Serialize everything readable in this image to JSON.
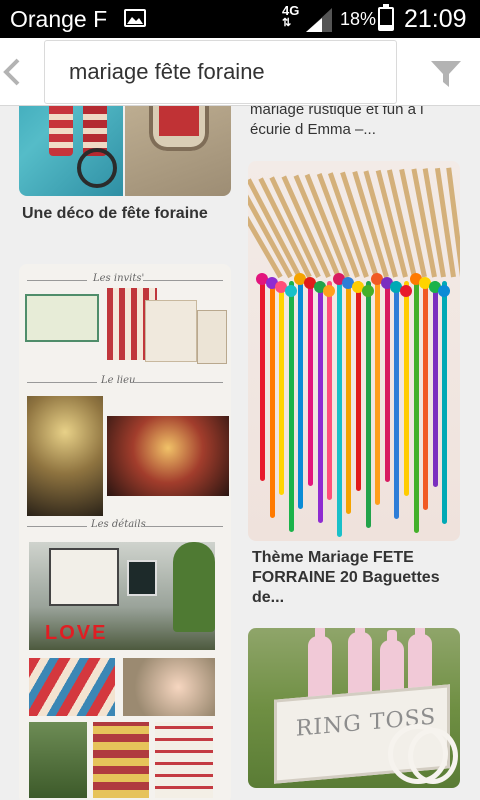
{
  "status_bar": {
    "carrier": "Orange F",
    "network": "4G",
    "battery_percent": "18%",
    "battery_level": 0.18,
    "time": "21:09"
  },
  "search": {
    "back_icon": "chevron-left-icon",
    "query": "mariage fête foraine",
    "filter_icon": "filter-funnel-icon"
  },
  "pins": {
    "left": [
      {
        "title": "Une déco de fête foraine"
      },
      {
        "title": "",
        "collage_labels": [
          "Les invits'",
          "Le lieu",
          "Les détails"
        ],
        "love_sign": "LOVE"
      }
    ],
    "right": [
      {
        "title": "mariage rustique et fun à l écurie d Emma –..."
      },
      {
        "title": "Thème Mariage FETE FORRAINE 20 Baguettes de..."
      },
      {
        "title": "",
        "crate_text": "RING TOSS"
      }
    ]
  },
  "colors": {
    "status_bg": "#000000",
    "feed_bg": "#efefef",
    "icon_gray": "#b3b3b3"
  }
}
